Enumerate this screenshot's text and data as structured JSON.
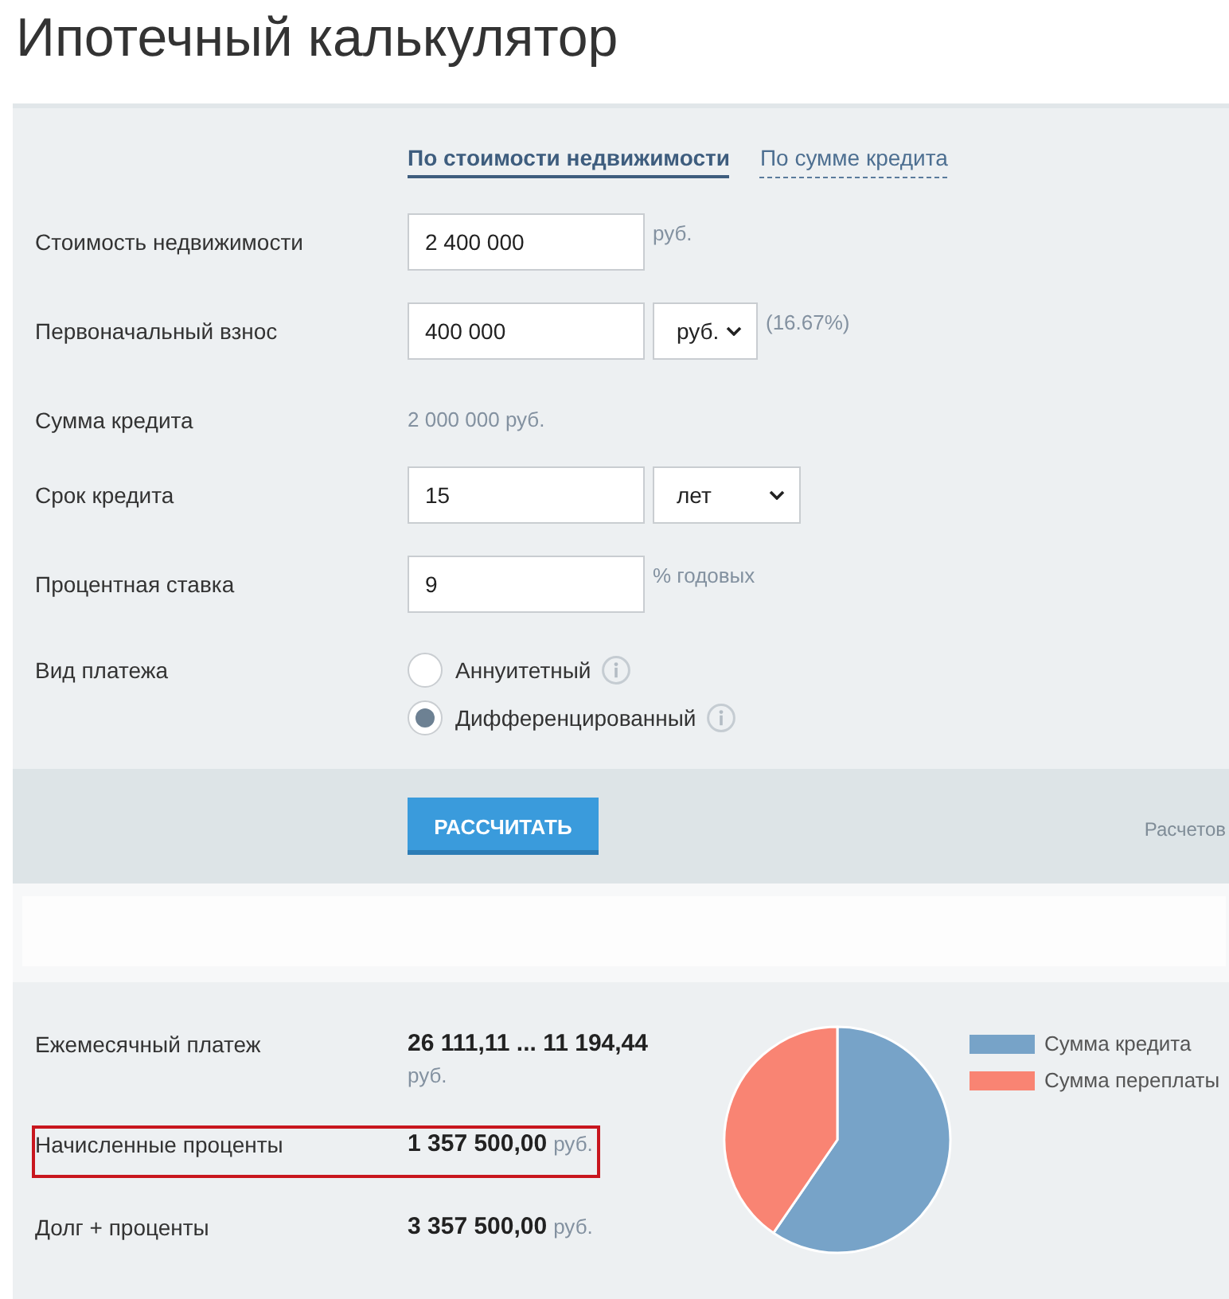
{
  "title": "Ипотечный калькулятор",
  "tabs": [
    {
      "label": "По стоимости недвижимости",
      "selected": true
    },
    {
      "label": "По сумме кредита",
      "selected": false
    }
  ],
  "fields": [
    {
      "kind": "input",
      "label": "Стоимость недвижимости",
      "value": "2 400 000",
      "unit": "руб."
    },
    {
      "kind": "input",
      "label": "Первоначальный взнос",
      "value": "400 000",
      "dropdown": "руб.",
      "note": "(16.67%)"
    },
    {
      "kind": "text",
      "label": "Сумма кредита",
      "value": "2 000 000 руб."
    },
    {
      "kind": "input",
      "label": "Срок кредита",
      "value": "15",
      "dropdown": "лет"
    },
    {
      "kind": "input",
      "label": "Процентная ставка",
      "value": "9",
      "unit": "% годовых"
    },
    {
      "kind": "radio",
      "label": "Вид платежа",
      "options": [
        {
          "label": "Аннуитетный",
          "selected": false
        },
        {
          "label": "Дифференцированный",
          "selected": true
        }
      ]
    }
  ],
  "calculate_button": "РАССЧИТАТЬ",
  "counter_text": "Расчетов",
  "results": [
    {
      "label": "Ежемесячный платеж",
      "amount": "26 111,11 ... 11 194,44",
      "unit": "руб.",
      "highlighted": false
    },
    {
      "label": "Начисленные проценты",
      "amount": "1 357 500,00",
      "unit": "руб.",
      "highlighted": true
    },
    {
      "label": "Долг + проценты",
      "amount": "3 357 500,00",
      "unit": "руб.",
      "highlighted": false
    }
  ],
  "chart": {
    "chart_data": {
      "type": "pie",
      "categories": [
        "Сумма кредита",
        "Сумма переплаты"
      ],
      "values": [
        59.57,
        40.43
      ]
    },
    "legend": [
      {
        "color": "#77a3c8"
      },
      {
        "color": "#f98473"
      }
    ]
  }
}
